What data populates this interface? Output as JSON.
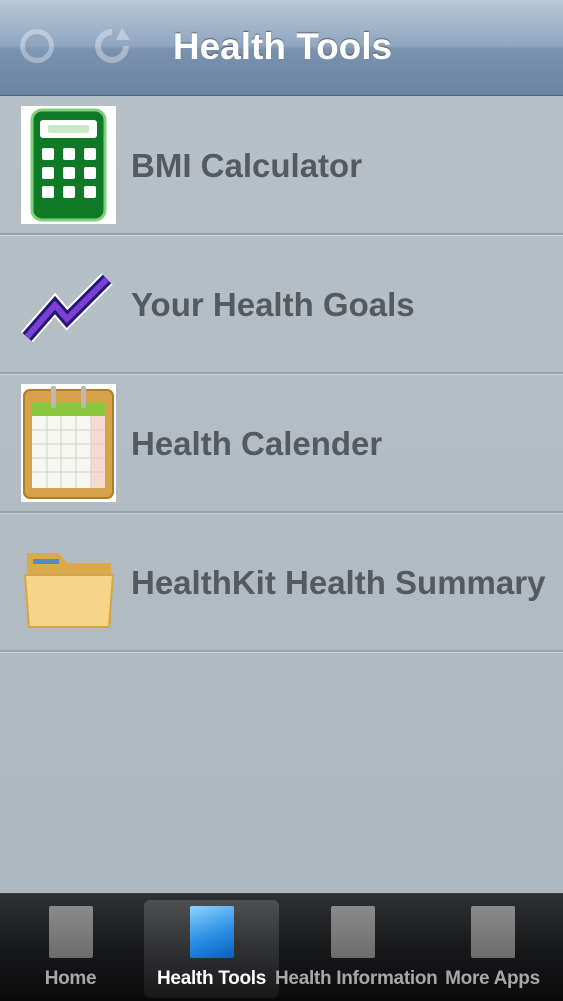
{
  "navbar": {
    "title": "Health Tools",
    "left_icons": [
      "info-icon",
      "refresh-icon"
    ]
  },
  "list": {
    "items": [
      {
        "label": "BMI Calculator",
        "icon": "calculator-icon"
      },
      {
        "label": "Your Health Goals",
        "icon": "trend-line-icon"
      },
      {
        "label": "Health Calender",
        "icon": "calendar-icon"
      },
      {
        "label": "HealthKit Health Summary",
        "icon": "folder-icon"
      }
    ]
  },
  "tabbar": {
    "tabs": [
      {
        "label": "Home",
        "active": false
      },
      {
        "label": "Health Tools",
        "active": true
      },
      {
        "label": "Health Information",
        "active": false
      },
      {
        "label": "More Apps",
        "active": false
      }
    ]
  },
  "colors": {
    "navbar": "#7a92ae",
    "background": "#b3bcc3",
    "row_text": "#555a5e",
    "tab_active": "#2a8fe6"
  }
}
